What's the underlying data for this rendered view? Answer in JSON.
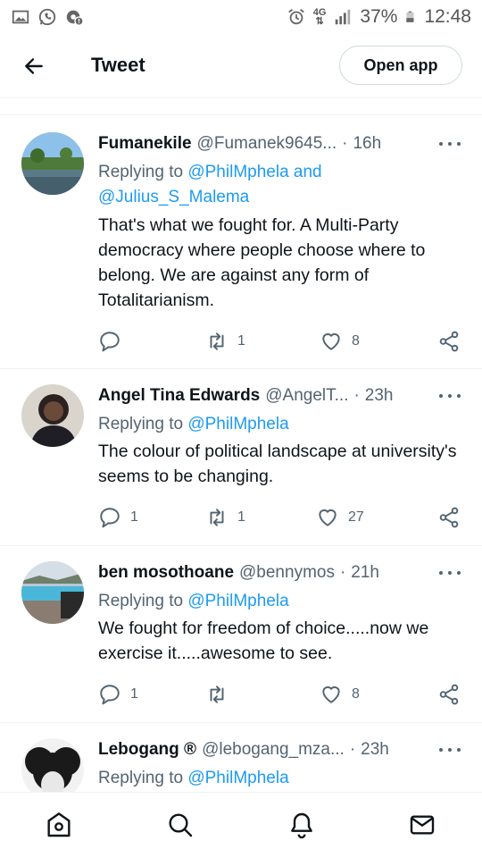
{
  "status_bar": {
    "battery_percent": "37%",
    "time": "12:48",
    "network": "4G",
    "icons": [
      "gallery-icon",
      "whatsapp-icon",
      "settings-notification-icon",
      "alarm-icon",
      "signal-icon",
      "battery-icon"
    ]
  },
  "header": {
    "title": "Tweet",
    "open_app_label": "Open app"
  },
  "tweets": [
    {
      "name": "Fumanekile",
      "handle": "@Fumanek9645...",
      "time": "16h",
      "replying_prefix": "Replying to",
      "replying_to_1": "@PhilMphela",
      "replying_and": "and",
      "replying_to_2": "@Julius_S_Malema",
      "text": "That's what we fought for. A Multi-Party democracy where people choose where to belong. We are against any form of Totalitarianism.",
      "replies": "",
      "retweets": "1",
      "likes": "8"
    },
    {
      "name": "Angel Tina Edwards",
      "handle": "@AngelT...",
      "time": "23h",
      "replying_prefix": "Replying to",
      "replying_to_1": "@PhilMphela",
      "text": "The colour of political landscape at university's seems to be changing.",
      "replies": "1",
      "retweets": "1",
      "likes": "27"
    },
    {
      "name": "ben mosothoane",
      "handle": "@bennymos",
      "time": "21h",
      "replying_prefix": "Replying to",
      "replying_to_1": "@PhilMphela",
      "text": "We fought for freedom of choice.....now we exercise it.....awesome to see.",
      "replies": "1",
      "retweets": "",
      "likes": "8"
    },
    {
      "name": "Lebogang ®",
      "handle": "@lebogang_mza...",
      "time": "23h",
      "replying_prefix": "Replying to",
      "replying_to_1": "@PhilMphela"
    }
  ],
  "bottom_nav": {
    "items": [
      "home-icon",
      "search-icon",
      "notifications-icon",
      "messages-icon"
    ]
  },
  "colors": {
    "link": "#1d9bf0",
    "secondary_text": "#536471",
    "primary_text": "#0f1419",
    "divider": "#eff3f4"
  }
}
